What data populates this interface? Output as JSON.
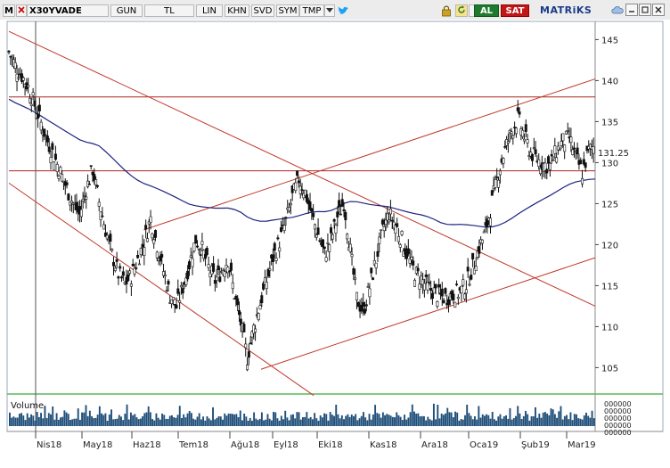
{
  "toolbar": {
    "m_label": "M",
    "symbol": "X30YVADE",
    "period": "GUN",
    "currency": "TL",
    "scale": "LIN",
    "buttons": [
      "KHN",
      "SVD",
      "SYM",
      "TMP"
    ],
    "buy_label": "AL",
    "sell_label": "SAT",
    "brand": "MATRiKS",
    "icons": [
      "menu-dropdown-icon",
      "twitter-icon",
      "lock-icon",
      "refresh-icon",
      "cloud-icon",
      "minimize-icon",
      "maximize-icon",
      "close-icon"
    ]
  },
  "chart_data": {
    "type": "candlestick",
    "title": "",
    "price_axis": {
      "ticks": [
        105,
        110,
        115,
        120,
        125,
        130,
        135,
        140,
        145
      ],
      "range": [
        102,
        147
      ],
      "last_price_label": "131.25"
    },
    "x_axis": {
      "labels": [
        "Nis18",
        "May18",
        "Haz18",
        "Tem18",
        "Ağu18",
        "Eyl18",
        "Eki18",
        "Kas18",
        "Ara18",
        "Oca19",
        "Şub19",
        "Mar19"
      ]
    },
    "close_series": [
      143.5,
      141.8,
      140.6,
      139.2,
      137.0,
      134.8,
      132.6,
      130.8,
      128.8,
      126.8,
      125.0,
      123.6,
      126.8,
      129.2,
      125.2,
      121.8,
      118.8,
      116.4,
      115.2,
      116.2,
      118.2,
      120.4,
      123.2,
      120.0,
      116.8,
      113.8,
      112.4,
      114.8,
      117.6,
      120.6,
      119.4,
      117.2,
      115.6,
      116.8,
      118.2,
      114.0,
      110.4,
      106.2,
      109.8,
      112.8,
      115.6,
      118.4,
      120.4,
      122.8,
      125.8,
      128.0,
      126.4,
      123.6,
      121.2,
      118.8,
      120.6,
      123.4,
      125.2,
      119.2,
      113.4,
      111.8,
      114.8,
      118.2,
      121.6,
      123.8,
      122.4,
      120.6,
      118.4,
      116.6,
      115.8,
      114.8,
      114.2,
      113.6,
      113.6,
      114.0,
      114.2,
      115.2,
      117.2,
      119.6,
      121.6,
      125.2,
      128.8,
      131.6,
      133.8,
      135.4,
      133.2,
      131.2,
      130.4,
      129.8,
      129.6,
      131.4,
      132.6,
      133.0,
      130.6,
      128.8,
      131.4,
      132.2
    ],
    "moving_average": {
      "start": 133.0,
      "end": 125.0
    },
    "horizontal_lines": [
      138.0,
      129.0
    ],
    "trend_lines": [
      {
        "from": [
          0.0,
          146.0
        ],
        "to": [
          1.0,
          112.5
        ]
      },
      {
        "from": [
          0.0,
          127.5
        ],
        "to": [
          0.52,
          101.6
        ]
      },
      {
        "from": [
          0.43,
          104.8
        ],
        "to": [
          1.0,
          118.4
        ]
      },
      {
        "from": [
          0.23,
          121.8
        ],
        "to": [
          1.0,
          140.2
        ]
      }
    ],
    "volume": {
      "label": "Volume",
      "axis_labels": [
        "000000",
        "000000",
        "000000",
        "000000",
        "000000"
      ]
    }
  }
}
